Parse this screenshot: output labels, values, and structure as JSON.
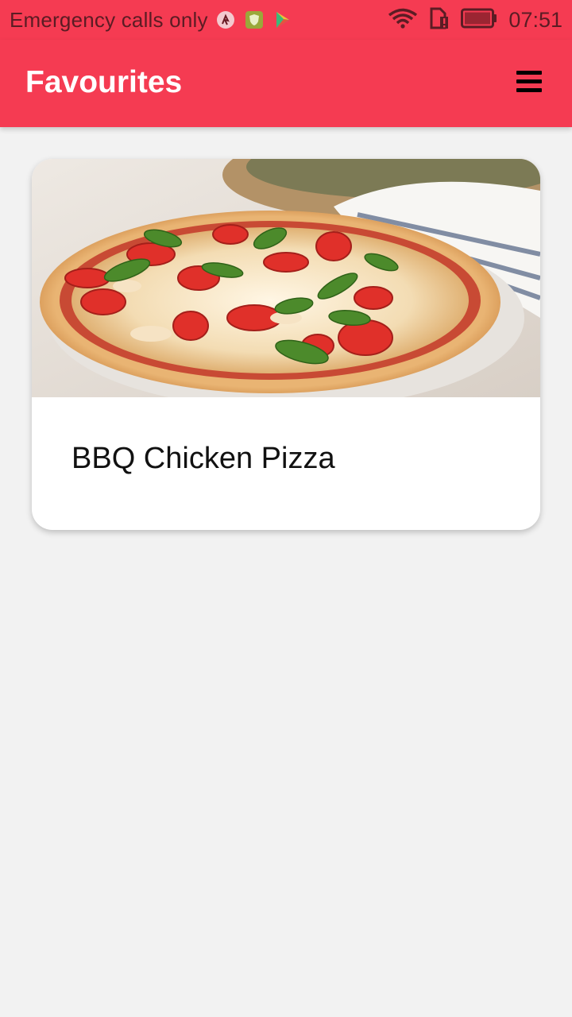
{
  "status_bar": {
    "carrier": "Emergency calls only",
    "time": "07:51",
    "notification_icons": [
      "ant-app-icon",
      "shield-app-icon",
      "play-store-icon"
    ],
    "system_icons": [
      "wifi-icon",
      "sim-alert-icon",
      "battery-icon"
    ]
  },
  "app_bar": {
    "title": "Favourites",
    "menu_icon": "hamburger-menu-icon"
  },
  "favourites": [
    {
      "title": "BBQ Chicken Pizza",
      "image": "pizza-photo"
    }
  ],
  "colors": {
    "accent": "#f53b52",
    "background": "#f2f2f2",
    "card": "#ffffff"
  }
}
